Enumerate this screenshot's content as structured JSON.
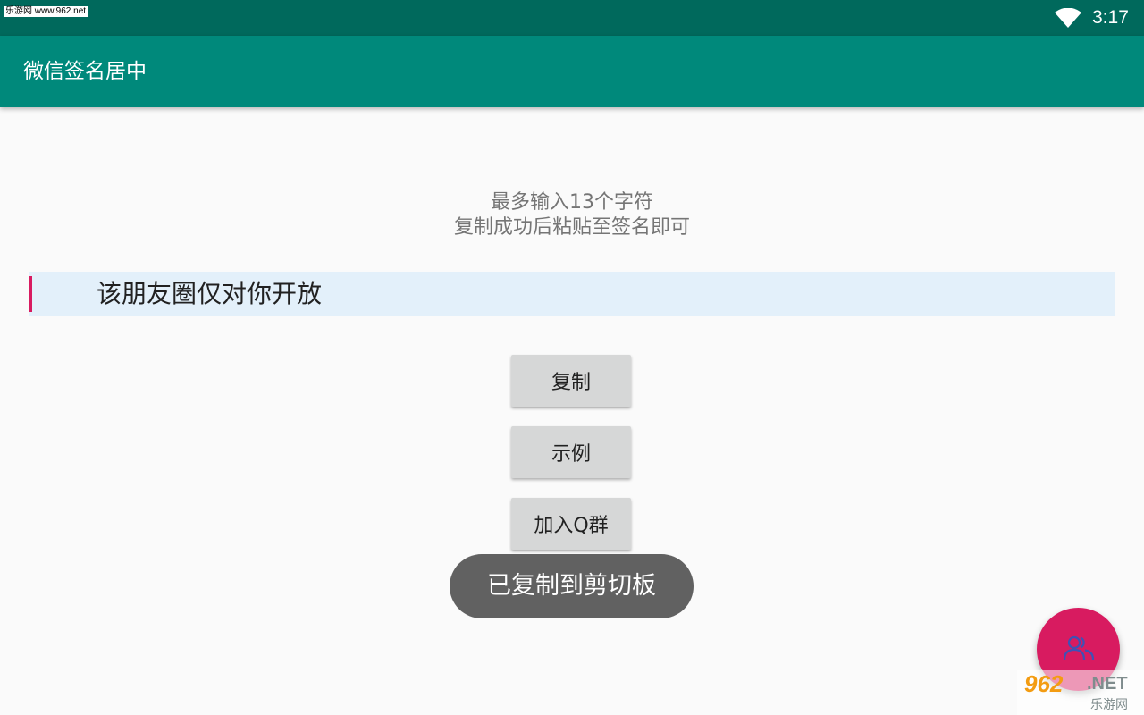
{
  "status_bar": {
    "watermark_label": "乐游网 www.962.net",
    "time": "3:17",
    "wifi_icon": "wifi-icon"
  },
  "app_bar": {
    "title": "微信签名居中",
    "color": "#00897b"
  },
  "hint": {
    "line1": "最多输入13个字符",
    "line2": "复制成功后粘贴至签名即可"
  },
  "input": {
    "value": "该朋友圈仅对你开放"
  },
  "buttons": {
    "copy": "复制",
    "example": "示例",
    "join_group": "加入Q群"
  },
  "toast": {
    "message": "已复制到剪切板"
  },
  "fab": {
    "icon": "people-icon",
    "color": "#d81b60"
  },
  "watermark": {
    "number": "962",
    "suffix": ".NET",
    "site_name": "乐游网"
  }
}
